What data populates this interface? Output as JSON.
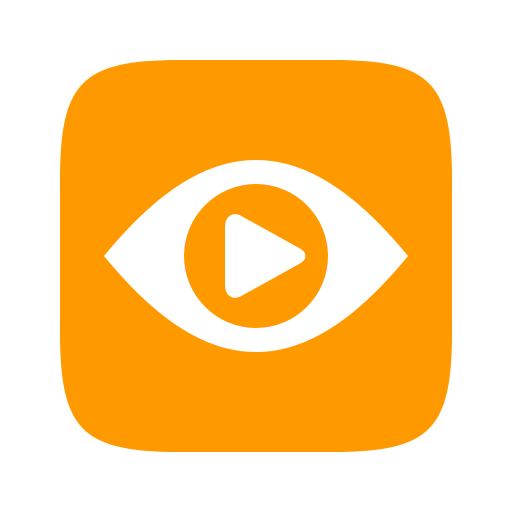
{
  "icon": {
    "name": "eye-play-app-icon",
    "colors": {
      "tile": "#FF9900",
      "foreground": "#FFFFFF",
      "background": "#FFFFFF"
    },
    "parts": [
      "rounded-square-tile",
      "eye-icon",
      "play-icon"
    ]
  }
}
